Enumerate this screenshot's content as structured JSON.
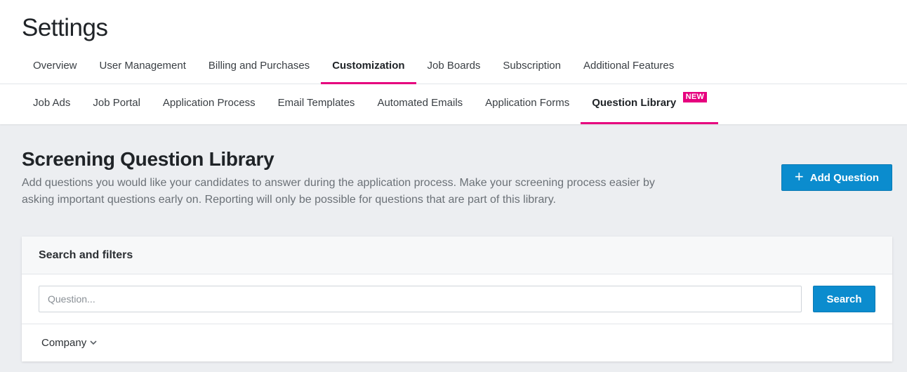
{
  "page": {
    "title": "Settings"
  },
  "main_tabs": [
    {
      "label": "Overview",
      "active": false
    },
    {
      "label": "User Management",
      "active": false
    },
    {
      "label": "Billing and Purchases",
      "active": false
    },
    {
      "label": "Customization",
      "active": true
    },
    {
      "label": "Job Boards",
      "active": false
    },
    {
      "label": "Subscription",
      "active": false
    },
    {
      "label": "Additional Features",
      "active": false
    }
  ],
  "sub_tabs": [
    {
      "label": "Job Ads",
      "active": false
    },
    {
      "label": "Job Portal",
      "active": false
    },
    {
      "label": "Application Process",
      "active": false
    },
    {
      "label": "Email Templates",
      "active": false
    },
    {
      "label": "Automated Emails",
      "active": false
    },
    {
      "label": "Application Forms",
      "active": false
    },
    {
      "label": "Question Library",
      "active": true,
      "badge": "NEW"
    }
  ],
  "section": {
    "title": "Screening Question Library",
    "description": "Add questions you would like your candidates to answer during the application process. Make your screening process easier by asking important questions early on. Reporting will only be possible for questions that are part of this library.",
    "add_button_label": "Add Question",
    "add_button_icon": "plus-icon"
  },
  "filters": {
    "title": "Search and filters",
    "search_placeholder": "Question...",
    "search_value": "",
    "search_button_label": "Search",
    "company_filter_label": "Company",
    "company_filter_icon": "chevron-down-icon"
  },
  "colors": {
    "accent": "#e6007e",
    "primary_button": "#0b8cce",
    "background": "#eceef1"
  }
}
